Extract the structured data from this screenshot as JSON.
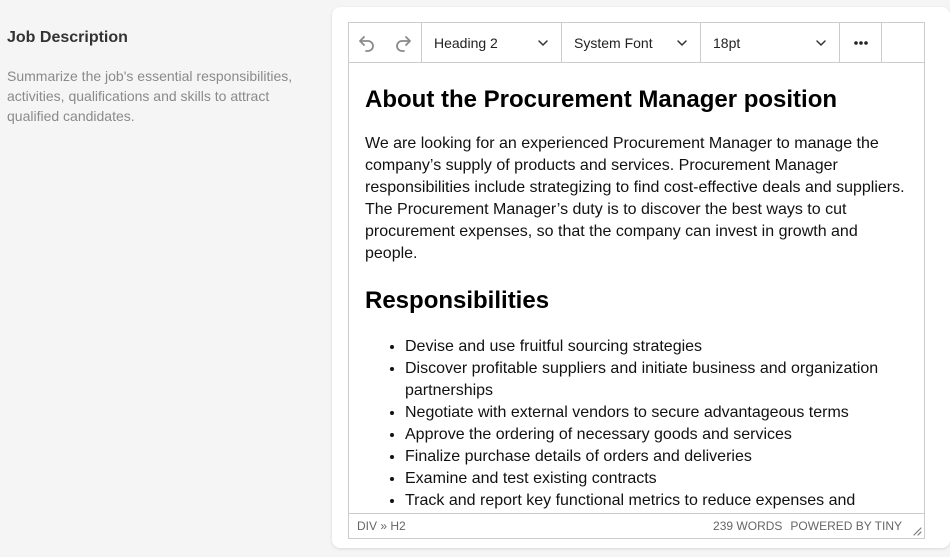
{
  "section": {
    "title": "Job Description",
    "description": "Summarize the job's essential responsibilities, activities, qualifications and skills to attract qualified candidates."
  },
  "toolbar": {
    "undo_icon": "undo-icon",
    "redo_icon": "redo-icon",
    "block_format": "Heading 2",
    "font_family": "System Font",
    "font_size": "18pt",
    "more_icon": "more-horizontal-icon"
  },
  "content": {
    "heading1": "About the Procurement Manager position",
    "intro": "We are looking for an experienced Procurement Manager to manage the company’s supply of products and services. Procurement Manager responsibilities include strategizing to find cost-effective deals and suppliers. The Procurement Manager’s duty is to discover the best ways to cut procurement expenses, so that the company can invest in growth and people.",
    "heading2": "Responsibilities",
    "responsibilities": [
      "Devise and use fruitful sourcing strategies",
      "Discover profitable suppliers and initiate business and organization partnerships",
      "Negotiate with external vendors to secure advantageous terms",
      "Approve the ordering of necessary goods and services",
      "Finalize purchase details of orders and deliveries",
      "Examine and test existing contracts",
      "Track and report key functional metrics to reduce expenses and"
    ]
  },
  "statusbar": {
    "path": "DIV » H2",
    "word_count": "239 WORDS",
    "branding": "POWERED BY TINY"
  },
  "colors": {
    "background": "#f5f5f5",
    "border": "#cccccc",
    "muted_text": "#8a8a8a"
  }
}
